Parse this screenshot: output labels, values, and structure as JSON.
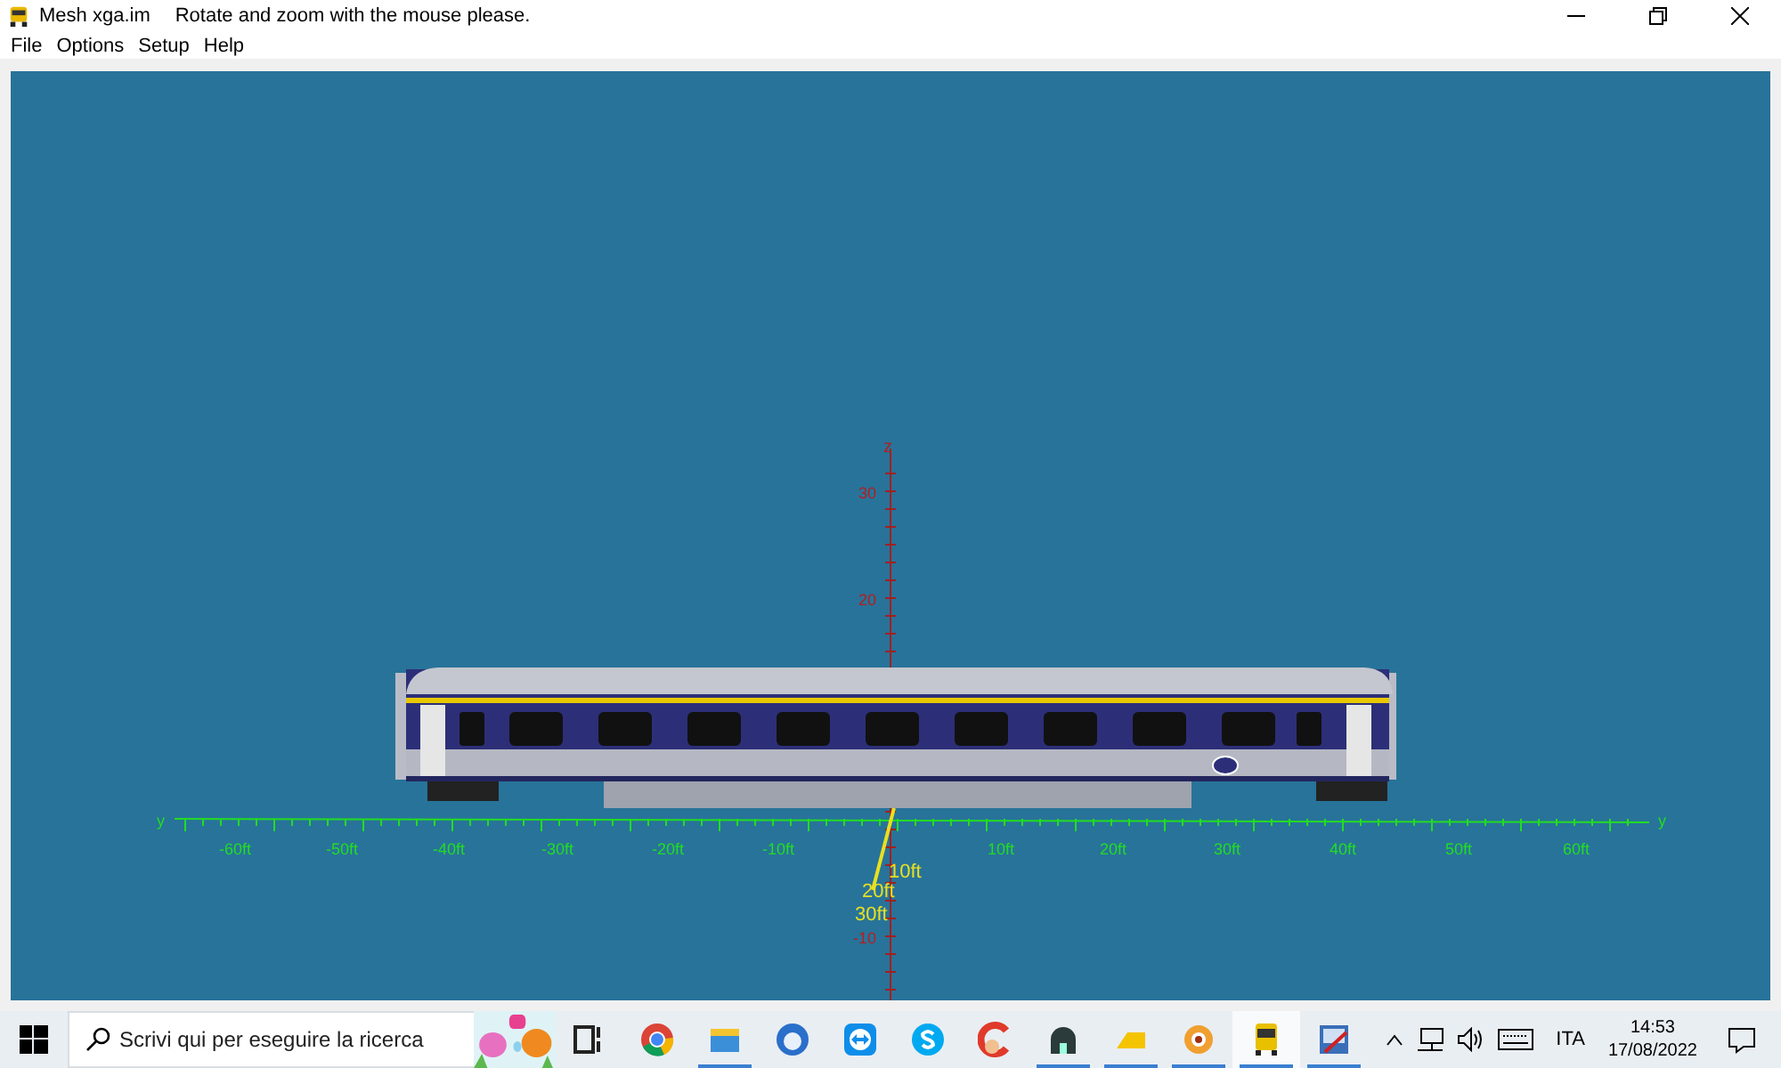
{
  "window": {
    "title": "Mesh xga.im",
    "hint": "Rotate and zoom with the mouse please."
  },
  "menu": [
    {
      "label": "File"
    },
    {
      "label": "Options"
    },
    {
      "label": "Setup"
    },
    {
      "label": "Help"
    }
  ],
  "viewport": {
    "axis_labels": [
      {
        "kind": "y",
        "text": "y"
      },
      {
        "kind": "y",
        "text": "y"
      },
      {
        "kind": "z",
        "text": "z"
      }
    ],
    "y_ticks": [
      "-60ft",
      "-50ft",
      "-40ft",
      "-30ft",
      "-20ft",
      "-10ft",
      "10ft",
      "20ft",
      "30ft",
      "40ft",
      "50ft",
      "60ft"
    ],
    "z_ticks": [
      "30",
      "20",
      "-10"
    ],
    "x_ticks": [
      "10ft",
      "20ft",
      "30ft"
    ]
  },
  "taskbar": {
    "search_placeholder": "Scrivi qui per eseguire la ricerca",
    "apps": [
      {
        "kind": "taskview",
        "running": false,
        "active": false
      },
      {
        "kind": "chrome",
        "running": false,
        "active": false
      },
      {
        "kind": "explorer",
        "running": true,
        "active": false
      },
      {
        "kind": "thunderbird",
        "running": false,
        "active": false
      },
      {
        "kind": "teamviewer",
        "running": false,
        "active": false
      },
      {
        "kind": "skype",
        "running": false,
        "active": false
      },
      {
        "kind": "ccleaner",
        "running": false,
        "active": false
      },
      {
        "kind": "dome",
        "running": true,
        "active": false
      },
      {
        "kind": "wedge",
        "running": true,
        "active": false
      },
      {
        "kind": "xnview",
        "running": true,
        "active": false
      },
      {
        "kind": "train",
        "running": true,
        "active": true
      },
      {
        "kind": "editor",
        "running": true,
        "active": false
      }
    ],
    "language": "ITA",
    "time": "14:53",
    "date": "17/08/2022"
  }
}
